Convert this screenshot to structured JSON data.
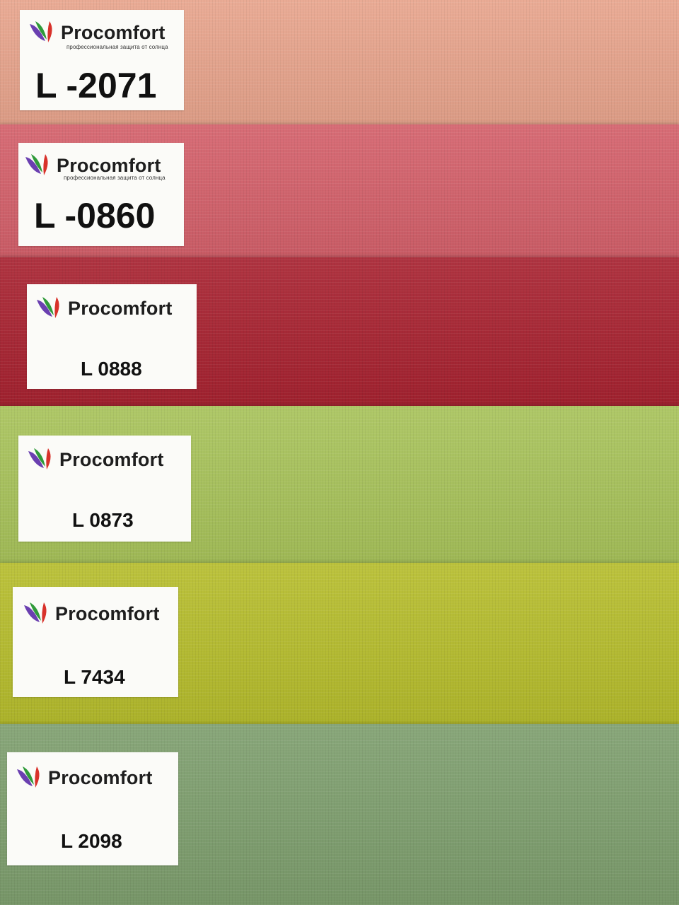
{
  "swatches": [
    {
      "brand": "Procomfort",
      "tagline": "профессиональная защита от солнца",
      "code": "L -2071",
      "color": "#e8a48c"
    },
    {
      "brand": "Procomfort",
      "tagline": "профессиональная защита от солнца",
      "code": "L -0860",
      "color": "#d4606a"
    },
    {
      "brand": "Procomfort",
      "code": "L 0888",
      "color": "#a82230"
    },
    {
      "brand": "Procomfort",
      "code": "L 0873",
      "color": "#a8c35a"
    },
    {
      "brand": "Procomfort",
      "code": "L 7434",
      "color": "#b6bd2c"
    },
    {
      "brand": "Procomfort",
      "code": "L 2098",
      "color": "#7e9f6e"
    }
  ],
  "logo_icon": "procomfort-leaf-logo-icon",
  "logo_colors": {
    "purple": "#6a3fb0",
    "green": "#2f9a3a",
    "red": "#d8312a"
  }
}
